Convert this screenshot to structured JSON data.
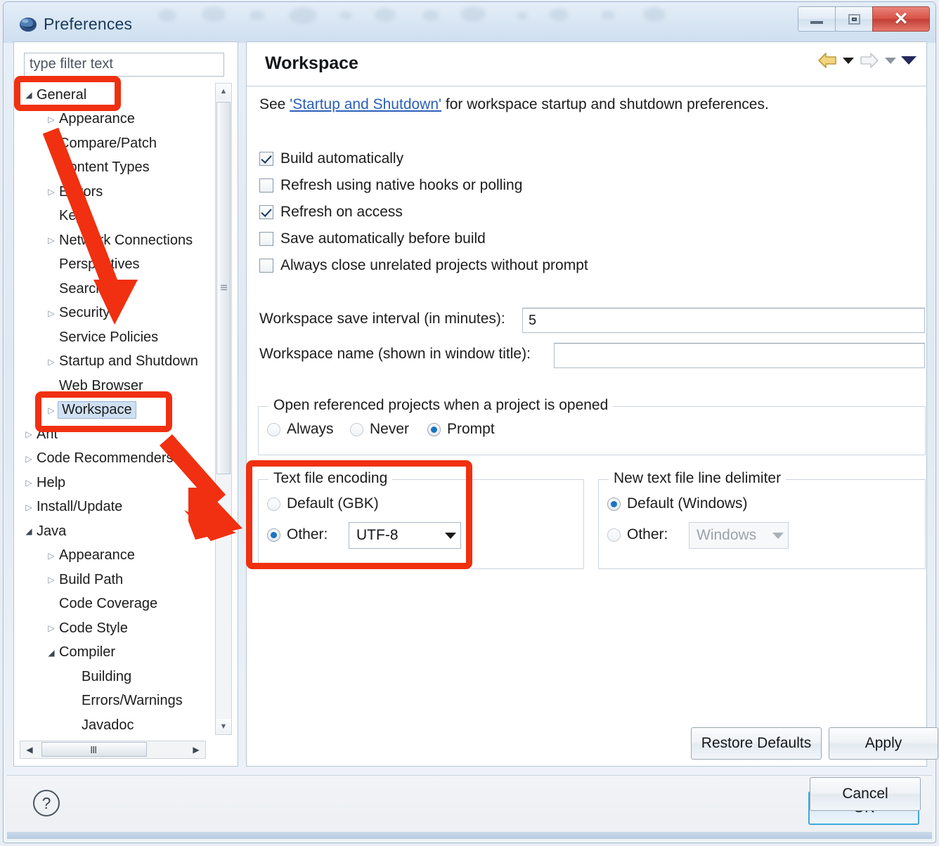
{
  "window": {
    "title": "Preferences",
    "icon": "eclipse-icon",
    "buttons": {
      "minimize": "minimize",
      "maximize": "maximize",
      "close": "close"
    }
  },
  "sidebar": {
    "filter": {
      "placeholder": "type filter text",
      "value": ""
    },
    "tree": [
      {
        "label": "General",
        "indent": 0,
        "twisty": "open",
        "selected": false
      },
      {
        "label": "Appearance",
        "indent": 1,
        "twisty": "collapsed",
        "selected": false
      },
      {
        "label": "Compare/Patch",
        "indent": 1,
        "twisty": "none",
        "selected": false
      },
      {
        "label": "Content Types",
        "indent": 1,
        "twisty": "none",
        "selected": false
      },
      {
        "label": "Editors",
        "indent": 1,
        "twisty": "collapsed",
        "selected": false
      },
      {
        "label": "Keys",
        "indent": 1,
        "twisty": "none",
        "selected": false
      },
      {
        "label": "Network Connections",
        "indent": 1,
        "twisty": "collapsed",
        "selected": false
      },
      {
        "label": "Perspectives",
        "indent": 1,
        "twisty": "none",
        "selected": false
      },
      {
        "label": "Search",
        "indent": 1,
        "twisty": "none",
        "selected": false
      },
      {
        "label": "Security",
        "indent": 1,
        "twisty": "collapsed",
        "selected": false
      },
      {
        "label": "Service Policies",
        "indent": 1,
        "twisty": "none",
        "selected": false
      },
      {
        "label": "Startup and Shutdown",
        "indent": 1,
        "twisty": "collapsed",
        "selected": false
      },
      {
        "label": "Web Browser",
        "indent": 1,
        "twisty": "none",
        "selected": false
      },
      {
        "label": "Workspace",
        "indent": 1,
        "twisty": "collapsed",
        "selected": true
      },
      {
        "label": "Ant",
        "indent": 0,
        "twisty": "collapsed",
        "selected": false
      },
      {
        "label": "Code Recommenders",
        "indent": 0,
        "twisty": "collapsed",
        "selected": false
      },
      {
        "label": "Help",
        "indent": 0,
        "twisty": "collapsed",
        "selected": false
      },
      {
        "label": "Install/Update",
        "indent": 0,
        "twisty": "collapsed",
        "selected": false
      },
      {
        "label": "Java",
        "indent": 0,
        "twisty": "open",
        "selected": false
      },
      {
        "label": "Appearance",
        "indent": 1,
        "twisty": "collapsed",
        "selected": false
      },
      {
        "label": "Build Path",
        "indent": 1,
        "twisty": "collapsed",
        "selected": false
      },
      {
        "label": "Code Coverage",
        "indent": 1,
        "twisty": "none",
        "selected": false
      },
      {
        "label": "Code Style",
        "indent": 1,
        "twisty": "collapsed",
        "selected": false
      },
      {
        "label": "Compiler",
        "indent": 1,
        "twisty": "open",
        "selected": false
      },
      {
        "label": "Building",
        "indent": 2,
        "twisty": "none",
        "selected": false
      },
      {
        "label": "Errors/Warnings",
        "indent": 2,
        "twisty": "none",
        "selected": false
      },
      {
        "label": "Javadoc",
        "indent": 2,
        "twisty": "none",
        "selected": false
      }
    ]
  },
  "content": {
    "title": "Workspace",
    "nav": {
      "back_icon": "back-arrow-icon",
      "back_menu_icon": "chevron-down-icon",
      "forward_icon": "forward-arrow-icon",
      "forward_menu_icon": "chevron-down-icon",
      "view_menu_icon": "chevron-down-icon"
    },
    "intro": {
      "before": "See ",
      "link": "'Startup and Shutdown'",
      "after": " for workspace startup and shutdown preferences."
    },
    "checkboxes": [
      {
        "label_pre": "B",
        "label_mn": "B",
        "label": "Build automatically",
        "checked": true
      },
      {
        "label": "Refresh using native hooks or polling",
        "checked": false
      },
      {
        "label": "Refresh on access",
        "checked": true
      },
      {
        "label": "Save automatically before build",
        "checked": false
      },
      {
        "label": "Always close unrelated projects without prompt",
        "checked": false
      }
    ],
    "fields": {
      "save_interval_label": "Workspace save interval (in minutes):",
      "save_interval_value": "5",
      "workspace_name_label": "Workspace name (shown in window title):",
      "workspace_name_value": ""
    },
    "open_referenced": {
      "legend": "Open referenced projects when a project is opened",
      "options": [
        {
          "label": "Always",
          "selected": false
        },
        {
          "label": "Never",
          "selected": false
        },
        {
          "label": "Prompt",
          "selected": true
        }
      ]
    },
    "text_file_encoding": {
      "legend": "Text file encoding",
      "default_label": "Default (GBK)",
      "default_selected": false,
      "other_label": "Other:",
      "other_selected": true,
      "other_value": "UTF-8"
    },
    "line_delimiter": {
      "legend": "New text file line delimiter",
      "default_label": "Default (Windows)",
      "default_selected": true,
      "other_label": "Other:",
      "other_selected": false,
      "other_value": "Windows",
      "other_disabled": true
    },
    "buttons": {
      "restore_defaults": "Restore Defaults",
      "apply": "Apply"
    }
  },
  "footer": {
    "help_icon": "question-mark-icon",
    "ok": "OK",
    "cancel": "Cancel"
  },
  "annotations": {
    "color": "#f03010",
    "highlights": [
      "general-tree-item",
      "workspace-tree-item",
      "text-file-encoding-group"
    ],
    "arrows": [
      "arrow-to-workspace",
      "arrow-to-text-file-encoding"
    ]
  }
}
